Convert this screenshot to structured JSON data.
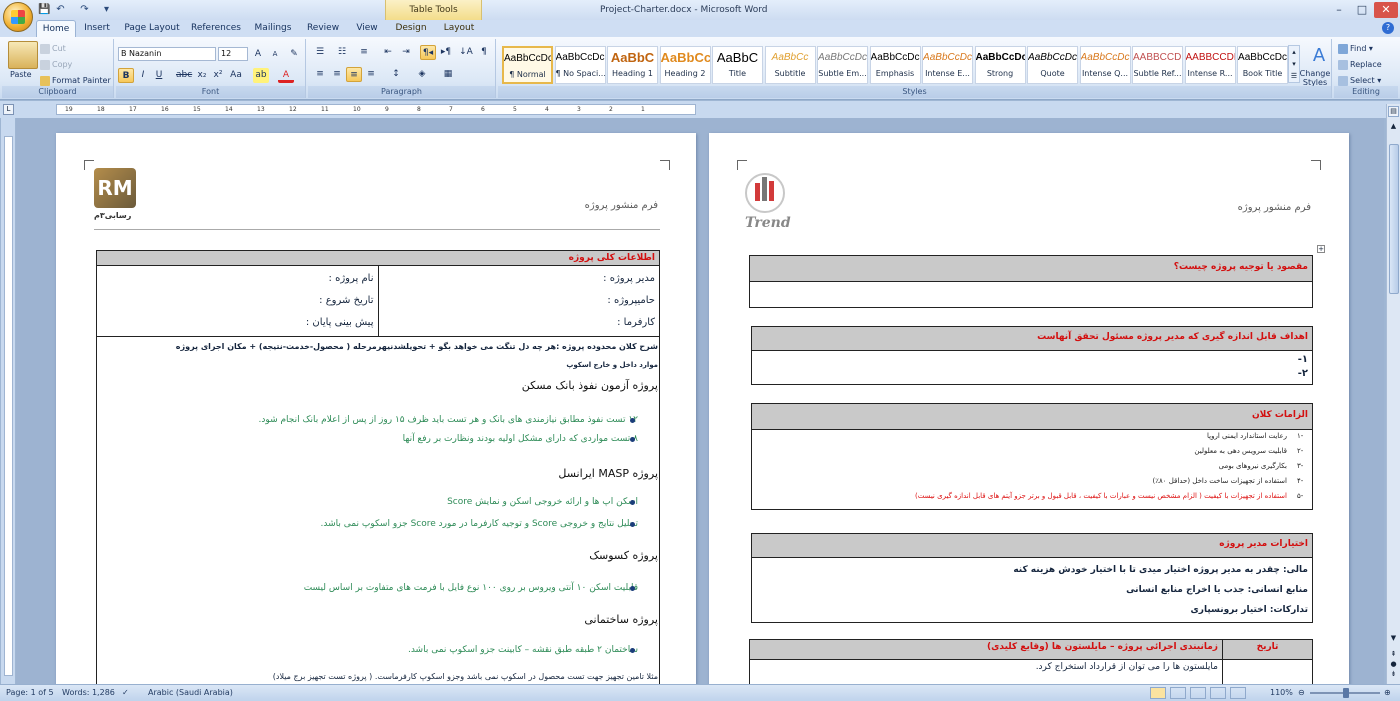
{
  "window": {
    "title": "Project-Charter.docx - Microsoft Word",
    "contextual_tab_group": "Table Tools"
  },
  "tabs": [
    "Home",
    "Insert",
    "Page Layout",
    "References",
    "Mailings",
    "Review",
    "View",
    "Design",
    "Layout"
  ],
  "clipboard": {
    "paste": "Paste",
    "cut": "Cut",
    "copy": "Copy",
    "format_painter": "Format Painter",
    "label": "Clipboard"
  },
  "font": {
    "name": "B Nazanin",
    "size": "12",
    "label": "Font"
  },
  "paragraph": {
    "label": "Paragraph"
  },
  "styles": {
    "label": "Styles",
    "items": [
      {
        "sample": "AaBbCcDc",
        "name": "¶ Normal",
        "color": "#000000"
      },
      {
        "sample": "AaBbCcDc",
        "name": "¶ No Spaci...",
        "color": "#000000"
      },
      {
        "sample": "AaBbC",
        "name": "Heading 1",
        "color": "#c0640f"
      },
      {
        "sample": "AaBbCc",
        "name": "Heading 2",
        "color": "#e08a1e"
      },
      {
        "sample": "AaBbC",
        "name": "Title",
        "color": "#000000"
      },
      {
        "sample": "AaBbCc",
        "name": "Subtitle",
        "color": "#e0a030"
      },
      {
        "sample": "AaBbCcDc",
        "name": "Subtle Em...",
        "color": "#777777"
      },
      {
        "sample": "AaBbCcDc",
        "name": "Emphasis",
        "color": "#000000"
      },
      {
        "sample": "AaBbCcDc",
        "name": "Intense E...",
        "color": "#d8781c"
      },
      {
        "sample": "AaBbCcDc",
        "name": "Strong",
        "color": "#000000"
      },
      {
        "sample": "AaBbCcDc",
        "name": "Quote",
        "color": "#000000"
      },
      {
        "sample": "AaBbCcDc",
        "name": "Intense Q...",
        "color": "#d8781c"
      },
      {
        "sample": "AABBCCDE",
        "name": "Subtle Ref...",
        "color": "#c05050"
      },
      {
        "sample": "AABBCCDE",
        "name": "Intense R...",
        "color": "#c01010"
      },
      {
        "sample": "AaBbCcDc",
        "name": "Book Title",
        "color": "#000000"
      }
    ],
    "change_styles": "Change Styles"
  },
  "editing": {
    "find": "Find",
    "replace": "Replace",
    "select": "Select",
    "label": "Editing"
  },
  "left_page": {
    "logo_text": "رسابی۳م",
    "header": "فرم منشور پروژه",
    "table_title": "اطلاعات کلی  پروژه",
    "fields": {
      "project_name": "نام پروژه :",
      "start_date": "تاریخ شروع :",
      "forecast_end": "پیش بینی پایان :",
      "project_manager": "مدیر پروژه :",
      "sponsor": "حامیپروژه :",
      "client": "کارفرما :"
    },
    "scope_line1": "شرح کلان محدوده پروژه :هر چه دل تنگت می خواهد بگو + تحویلشدنیهرمرحله ( محصول-خدمت-نتیجه) + مکان اجرای پروژه",
    "scope_line2": "موارد داخل و خارج اسکوپ",
    "projects": [
      {
        "title": "پروژه آزمون نفوذ بانک مسکن",
        "bullets": [
          "۱۲ تست نفوذ مطابق نیازمندی های بانک و هر تست باید ظرف ۱۵ روز از پس از اعلام بانک انجام شود.",
          "۸ تست مواردی که دارای مشکل اولیه بودند ونظارت بر رفع آنها"
        ]
      },
      {
        "title": "پروژه MASP ایرانسل",
        "bullets": [
          "اسکن اپ ها و ارائه خروجی اسکن و نمایش Score",
          "تحلیل نتایج و خروجی Score و توجیه کارفرما در مورد Score جزو اسکوپ نمی باشد."
        ]
      },
      {
        "title": "پروژه کسوسک",
        "bullets": [
          "قابلیت اسکن ۱۰ آنتی ویروس بر روی ۱۰۰ نوع فایل با فرمت های متفاوت بر اساس لیست"
        ]
      },
      {
        "title": "پروژه ساختمانی",
        "bullets": [
          "ساختمان ۲ طبقه طبق نقشه – کابینت جزو اسکوپ نمی باشد."
        ]
      }
    ],
    "last_line": "مثلا تامین تجهیز جهت تست محصول در اسکوپ نمی باشد وجزو اسکوپ کارفرماست. ( پروژه تست تجهیز برج میلاد)"
  },
  "right_page": {
    "logo_text": "Trend",
    "header": "فرم منشور پروژه",
    "q1": "مقصود یا توجیه پروژه چیست؟",
    "q2": "اهداف قابل اندازه گیری که مدیر پروژه مسئول تحقق آنهاست",
    "q2_items": [
      "۱-",
      "۲-"
    ],
    "q3": "الزامات کلان",
    "q3_items": [
      {
        "n": "۱-",
        "t": "رعایت استاندارد ایمنی اروپا",
        "red": false
      },
      {
        "n": "۲-",
        "t": "قابلیت سرویس دهی به معلولین",
        "red": false
      },
      {
        "n": "۳-",
        "t": "بکارگیری نیروهای بومی",
        "red": false
      },
      {
        "n": "۴-",
        "t": "استفاده از تجهیزات ساخت داخل (حداقل ۸۰٪)",
        "red": false
      },
      {
        "n": "۵-",
        "t": "استفاده از تجهیزات با کیفیت ( الزام مشخص نیست و عبارات با کیفیت ، قابل قبول و برتر جزو آیتم های قابل اندازه گیری نیست)",
        "red": true
      }
    ],
    "q4": "اختیارات مدیر پروژه",
    "q4_items": [
      "مالی: چقدر به مدیر پروژه اختیار میدی تا با اختیار خودش هزینه کنه",
      "منابع انسانی: جذب یا اخراج منابع انسانی",
      "تدارکات: اختیار برونسپاری"
    ],
    "q5": "زمانبندی اجرائی پروژه – مایلستون ها (وقایع کلیدی)",
    "q5_date": "تاریخ",
    "q5_text": "مایلستون ها را می توان از قرارداد استخراج کرد."
  },
  "status": {
    "page": "Page: 1 of 5",
    "words": "Words: 1,286",
    "language": "Arabic (Saudi Arabia)",
    "zoom": "110%"
  }
}
